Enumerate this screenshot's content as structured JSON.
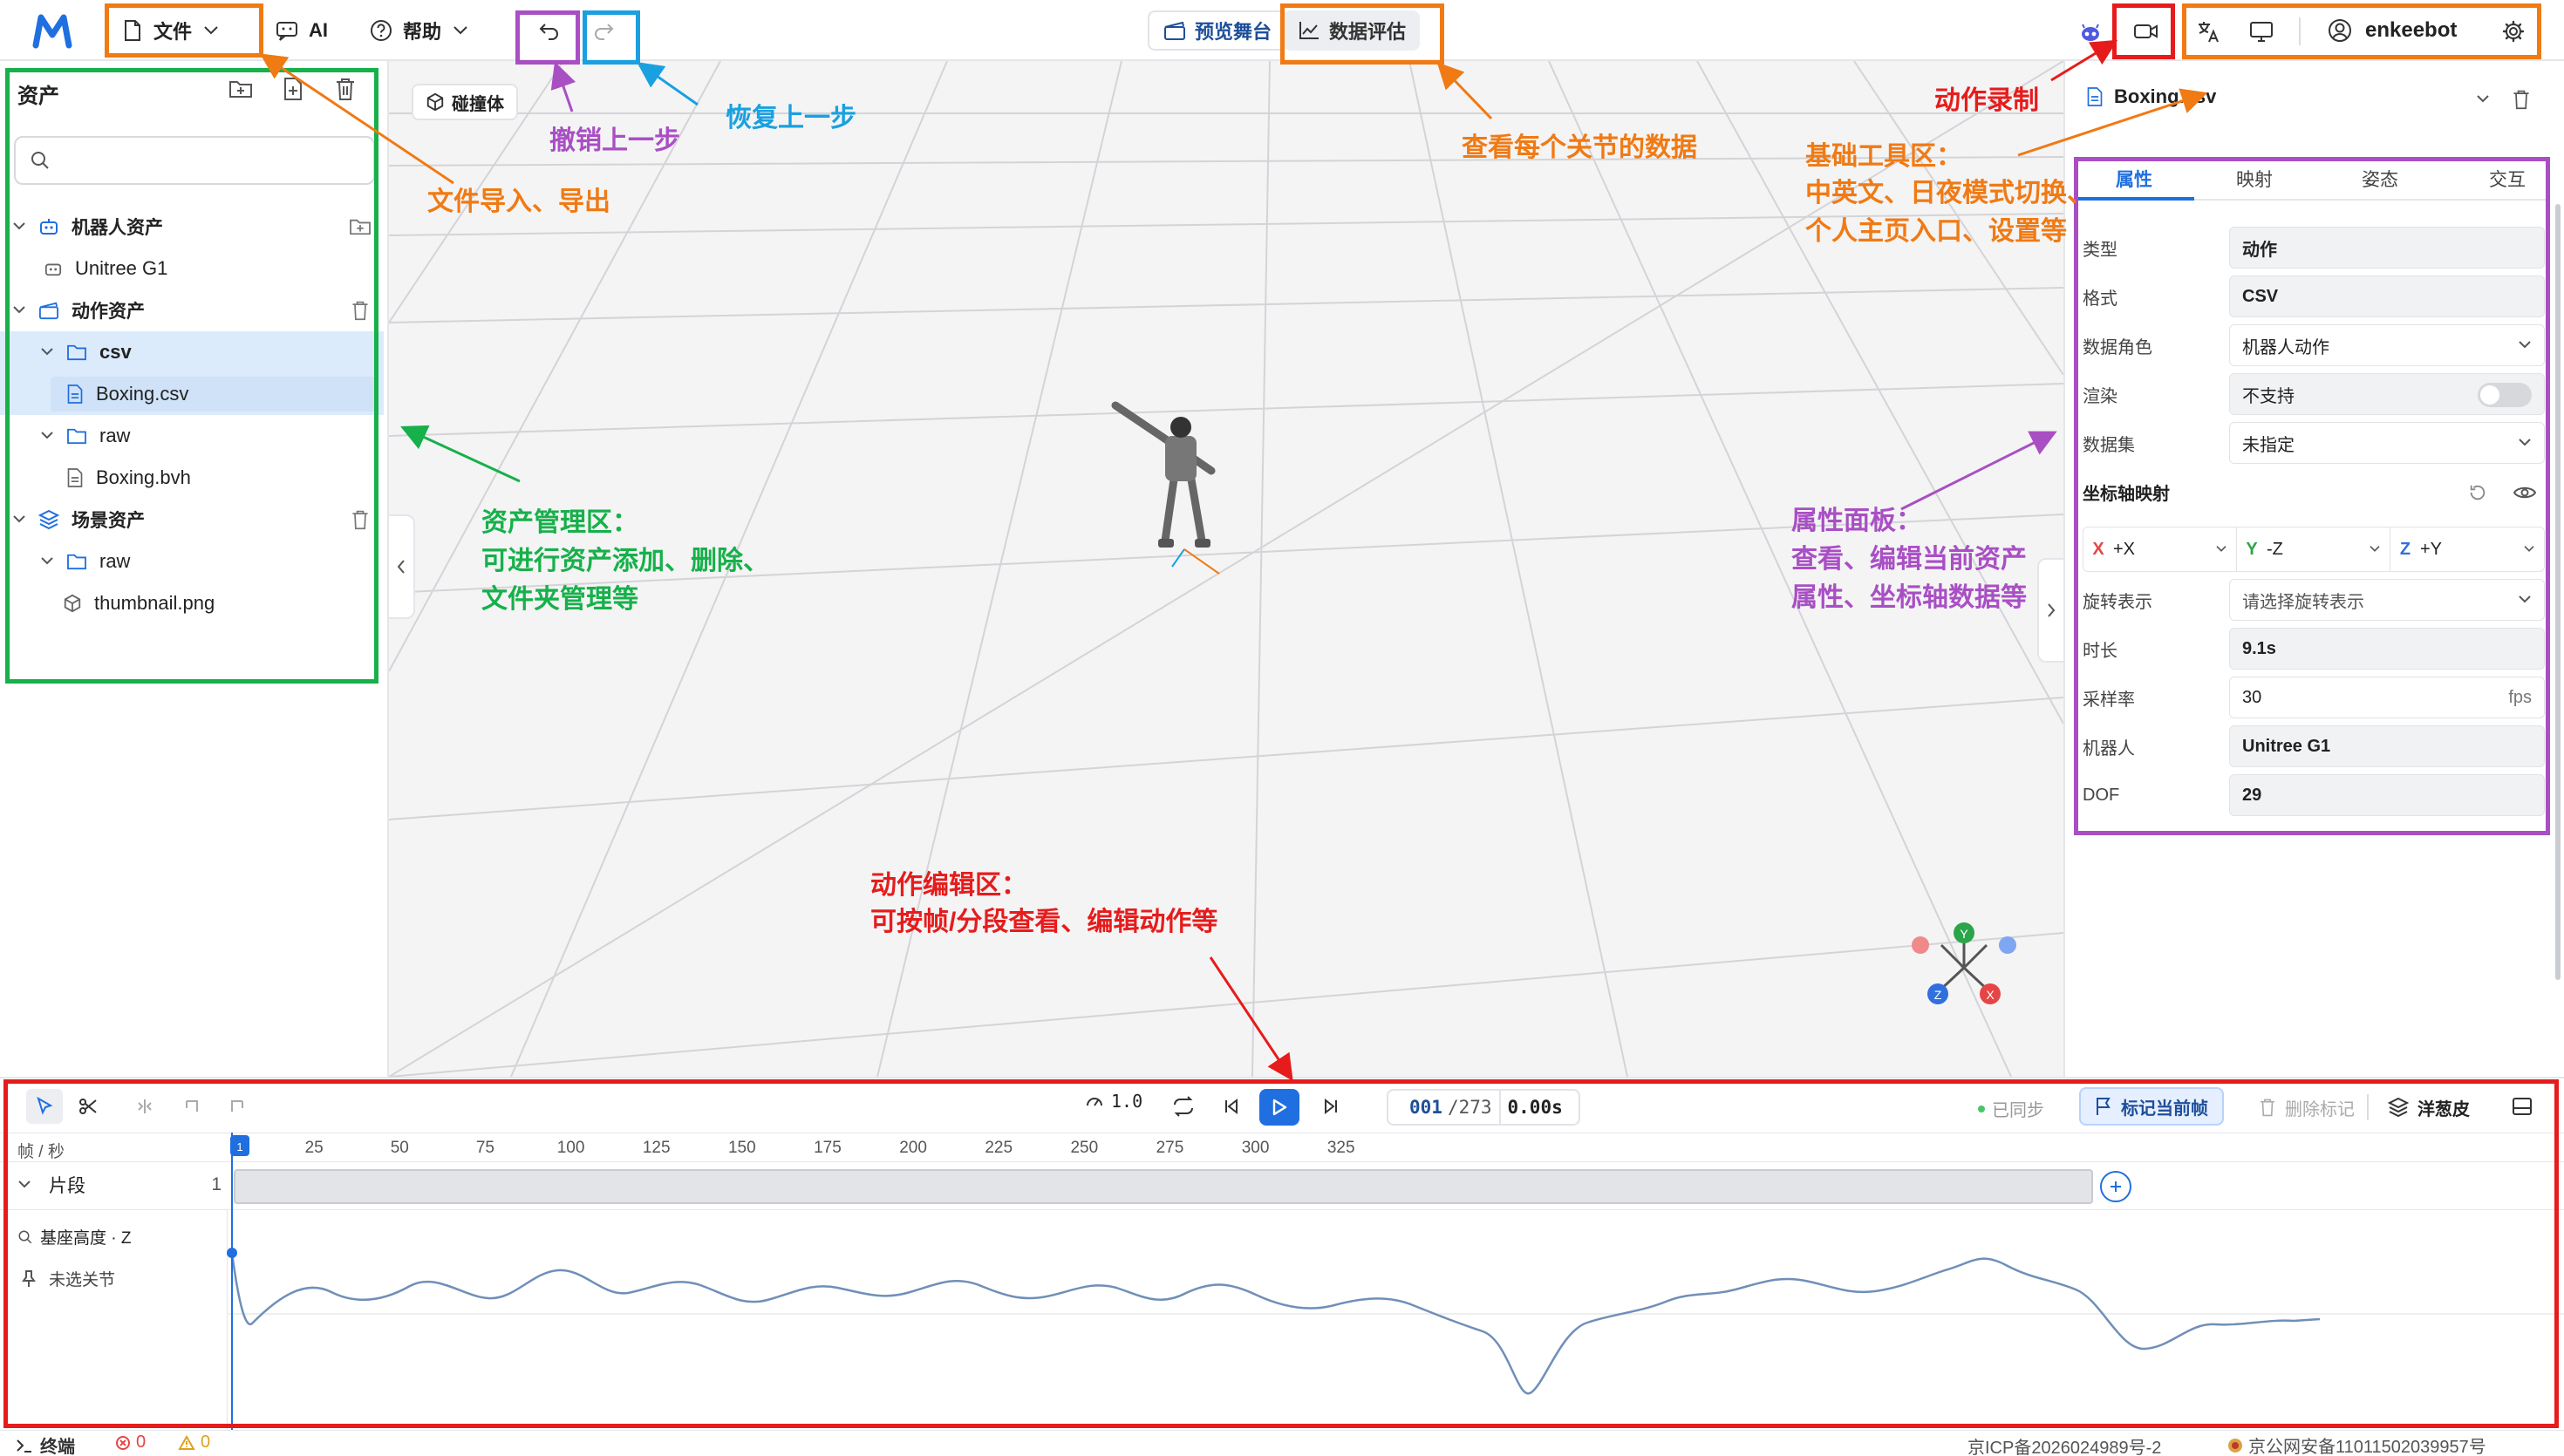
{
  "topbar": {
    "logo": "M",
    "file_label": "文件",
    "ai_label": "AI",
    "help_label": "帮助",
    "preview_stage": "预览舞台",
    "data_eval": "数据评估",
    "username": "enkeebot"
  },
  "left": {
    "title": "资产",
    "search_placeholder": "",
    "robot_assets": "机器人资产",
    "robot_item": "Unitree G1",
    "motion_assets": "动作资产",
    "folder_csv": "csv",
    "file_csv": "Boxing.csv",
    "folder_raw": "raw",
    "file_bvh": "Boxing.bvh",
    "scene_assets": "场景资产",
    "scene_raw": "raw",
    "scene_png": "thumbnail.png"
  },
  "viewport": {
    "collider_label": "碰撞体"
  },
  "right": {
    "filename": "Boxing.csv",
    "tabs": [
      "属性",
      "映射",
      "姿态",
      "交互"
    ],
    "type_label": "类型",
    "type_value": "动作",
    "format_label": "格式",
    "format_value": "CSV",
    "role_label": "数据角色",
    "role_value": "机器人动作",
    "render_label": "渲染",
    "render_value": "不支持",
    "dataset_label": "数据集",
    "dataset_value": "未指定",
    "axis_map_label": "坐标轴映射",
    "axis_x": "X",
    "axis_x_val": "+X",
    "axis_y": "Y",
    "axis_y_val": "-Z",
    "axis_z": "Z",
    "axis_z_val": "+Y",
    "rot_label": "旋转表示",
    "rot_value": "请选择旋转表示",
    "duration_label": "时长",
    "duration_value": "9.1s",
    "rate_label": "采样率",
    "rate_value": "30",
    "rate_unit": "fps",
    "robot_label": "机器人",
    "robot_value": "Unitree G1",
    "dof_label": "DOF",
    "dof_value": "29"
  },
  "timeline": {
    "speed": "1.0",
    "frame_current": "001",
    "frame_total": "/273",
    "time": "0.00s",
    "synced": "已同步",
    "mark_frame": "标记当前帧",
    "delete_mark": "删除标记",
    "onion": "洋葱皮",
    "unit_label": "帧 / 秒",
    "ticks": [
      "25",
      "50",
      "75",
      "100",
      "125",
      "150",
      "175",
      "200",
      "225",
      "250",
      "275",
      "300",
      "325"
    ],
    "segment_label": "片段",
    "segment_count": "1",
    "curve_label": "基座高度 · Z",
    "joint_label": "未选关节"
  },
  "statusbar": {
    "terminal": "终端",
    "errors": "0",
    "warnings": "0",
    "icp": "京ICP备2026024989号-2",
    "police": "京公网安备11011502039957号"
  },
  "annotations": {
    "file_io": "文件导入、导出",
    "undo": "撤销上一步",
    "redo": "恢复上一步",
    "joint_data": "查看每个关节的数据",
    "recording": "动作录制",
    "toolbar_l1": "基础工具区：",
    "toolbar_l2": "中英文、日夜模式切换、",
    "toolbar_l3": "个人主页入口、设置等",
    "asset_l1": "资产管理区：",
    "asset_l2": "可进行资产添加、删除、",
    "asset_l3": "文件夹管理等",
    "prop_l1": "属性面板：",
    "prop_l2": "查看、编辑当前资产",
    "prop_l3": "属性、坐标轴数据等",
    "edit_l1": "动作编辑区：",
    "edit_l2": "可按帧/分段查看、编辑动作等"
  },
  "colors": {
    "orange": "#f07a14",
    "green": "#17b04a",
    "blue": "#1aa0e0",
    "purple": "#a94fc4",
    "red": "#e61c1c",
    "accent": "#1f6fe0"
  }
}
